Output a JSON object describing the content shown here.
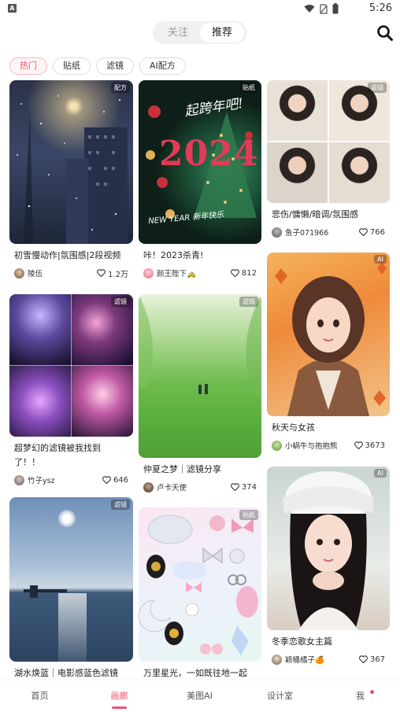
{
  "status_bar": {
    "time": "5:26",
    "app_icon_letter": "A"
  },
  "top_tabs": [
    {
      "label": "关注",
      "active": false
    },
    {
      "label": "推荐",
      "active": true
    }
  ],
  "chips": [
    {
      "label": "热门",
      "active": true
    },
    {
      "label": "贴纸",
      "active": false
    },
    {
      "label": "滤镜",
      "active": false
    },
    {
      "label": "AI配方",
      "active": false
    }
  ],
  "feed": {
    "col1": [
      {
        "tag": "配方",
        "title": "初雪慢动作|氛围感|2段视频",
        "author": "陵伍",
        "likes": "1.2万"
      },
      {
        "tag": "滤镜",
        "title": "超梦幻的滤镜被我找到\n了！！",
        "author": "竹子ysz",
        "likes": "646"
      },
      {
        "tag": "滤镜",
        "title": "湖水焕蓝｜电影感蓝色滤镜",
        "author": "",
        "likes": ""
      }
    ],
    "col2": [
      {
        "tag": "贴纸",
        "title": "咔！2023杀青!",
        "author": "颜王陛下🚕",
        "likes": "812"
      },
      {
        "tag": "滤镜",
        "title": "仲夏之梦｜滤镜分享",
        "author": "卢卡天使",
        "likes": "374"
      },
      {
        "tag": "贴纸",
        "title": "万里星光，一如既往地一起",
        "author": "",
        "likes": ""
      }
    ],
    "col3": [
      {
        "tag": "滤镜",
        "title": "悲伤/慵懒/暗调/氛围感",
        "author": "鱼子071966",
        "likes": "766"
      },
      {
        "tag": "AI",
        "title": "秋天与女孩",
        "author": "小蜗牛与抱抱熊",
        "likes": "3673"
      },
      {
        "tag": "AI",
        "title": "冬季恋歌女主篇",
        "author": "颖桶橘子🍊",
        "likes": "367"
      }
    ]
  },
  "image_text": {
    "newyear_top": "起跨年吧!",
    "newyear_year": "2024",
    "newyear_bottom": "NEW YEAR 新年快乐"
  },
  "bottom_nav": [
    {
      "label": "首页",
      "active": false
    },
    {
      "label": "画廊",
      "active": true
    },
    {
      "label": "美图AI",
      "active": false
    },
    {
      "label": "设计室",
      "active": false
    },
    {
      "label": "我",
      "active": false,
      "badge": true
    }
  ],
  "colors": {
    "accent": "#f0506e",
    "chip_active_bg": "#fff5f7",
    "segment_bg": "#f1f1f1"
  }
}
